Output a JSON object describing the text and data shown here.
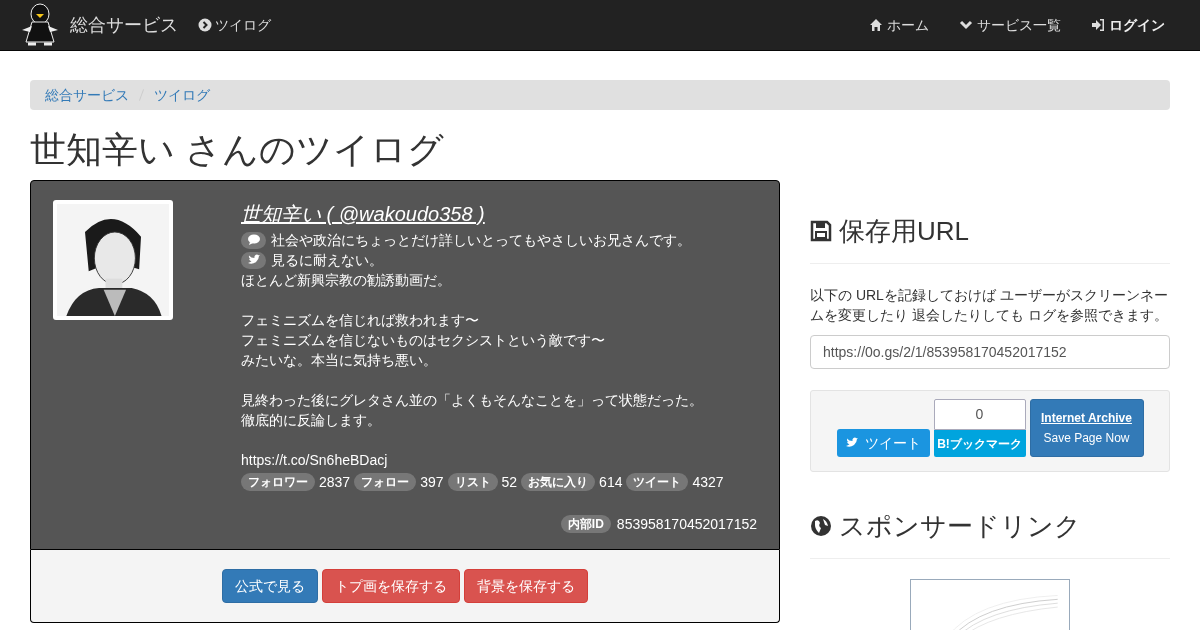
{
  "navbar": {
    "brand": "総合サービス",
    "left_links": [
      {
        "kind": "chevron-circle",
        "label": "ツイログ"
      }
    ],
    "right_links": [
      {
        "kind": "home",
        "label": "ホーム",
        "bold": false
      },
      {
        "kind": "chevron-down",
        "label": "サービス一覧",
        "bold": false
      },
      {
        "kind": "sign-in",
        "label": "ログイン",
        "bold": true
      }
    ]
  },
  "breadcrumb": [
    "総合サービス",
    "ツイログ"
  ],
  "heading": "世知辛い さんのツイログ",
  "profile": {
    "name_link": "世知辛い ( @wakoudo358 )",
    "lines": [
      {
        "kind": "comment",
        "text": "社会や政治にちょっとだけ詳しいとってもやさしいお兄さんです。"
      },
      {
        "kind": "twitter",
        "text": "見るに耐えない。"
      }
    ],
    "paragraphs": [
      [
        "ほとんど新興宗教の勧誘動画だ。"
      ],
      [
        "フェミニズムを信じれば救われます〜",
        "フェミニズムを信じないものはセクシストという敵です〜",
        "みたいな。本当に気持ち悪い。"
      ],
      [
        "見終わった後にグレタさん並の「よくもそんなことを」って状態だった。",
        "徹底的に反論します。"
      ],
      [
        "https://t.co/Sn6heBDacj"
      ]
    ],
    "stats": [
      {
        "label": "フォロワー",
        "value": "2837"
      },
      {
        "label": "フォロー",
        "value": "397"
      },
      {
        "label": "リスト",
        "value": "52"
      },
      {
        "label": "お気に入り",
        "value": "614"
      },
      {
        "label": "ツイート",
        "value": "4327"
      }
    ],
    "internal_id": {
      "label": "内部ID",
      "value": "853958170452017152"
    },
    "buttons": [
      {
        "label": "公式で見る",
        "kind": "primary"
      },
      {
        "label": "トプ画を保存する",
        "kind": "danger"
      },
      {
        "label": "背景を保存する",
        "kind": "danger"
      }
    ]
  },
  "save_url": {
    "title": "保存用URL",
    "description": "以下の URLを記録しておけば ユーザーがスクリーンネームを変更したり 退会したりしても ログを参照できます。",
    "url": "https://0o.gs/2/1/853958170452017152",
    "tweet_button": "ツイート",
    "bookmark_count": "0",
    "bookmark_button": "B!ブックマーク",
    "archive_title": "Internet Archive",
    "archive_action": "Save Page Now"
  },
  "sponsor": {
    "title": "スポンサードリンク"
  }
}
